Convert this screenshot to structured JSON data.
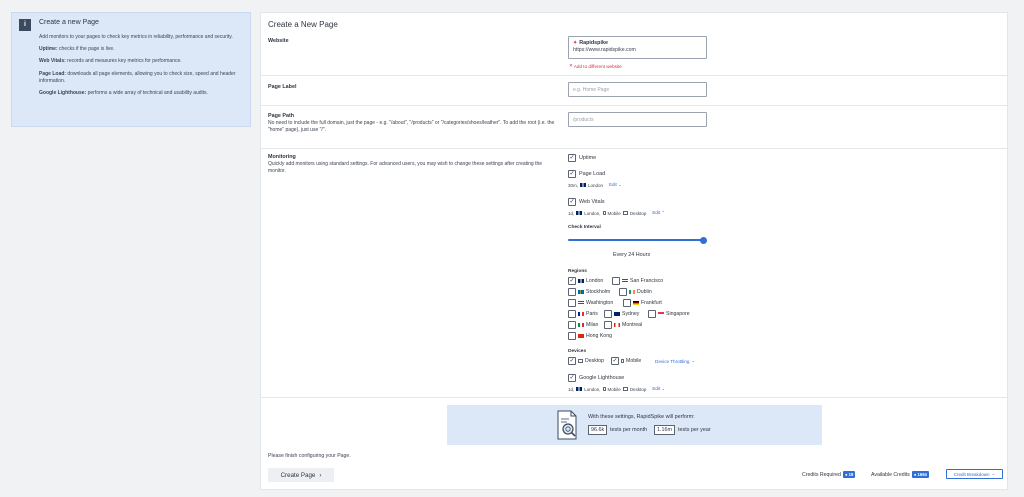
{
  "info": {
    "badge": "i",
    "title": "Create a new Page",
    "intro": "Add monitors to your pages to check key metrics in reliability, performance and security.",
    "items": [
      {
        "term": "Uptime:",
        "text": " checks if the page is live."
      },
      {
        "term": "Web Vitals:",
        "text": " records and measures key metrics for performance."
      },
      {
        "term": "Page Load:",
        "text": " downloads all page elements, allowing you to check size, speed and header information."
      },
      {
        "term": "Google Lighthouse:",
        "text": " performs a wide array of technical and usability audits."
      }
    ]
  },
  "form": {
    "title": "Create a New Page",
    "website": {
      "label": "Website",
      "site_name": "Rapidspike",
      "site_url": "https://www.rapidspike.com",
      "change_link": "Add to different website"
    },
    "page_label": {
      "label": "Page Label",
      "placeholder": "e.g. Home Page"
    },
    "page_path": {
      "label": "Page Path",
      "description": "No need to include the full domain, just the page - e.g. \"/about\", \"/products\" or \"/categories/shoes/leather\". To add the root (i.e. the \"home\" page), just use \"/\".",
      "placeholder": "/products"
    },
    "monitoring": {
      "label": "Monitoring",
      "description": "Quickly add monitors using standard settings. For advanced users, you may wish to change these settings after creating the monitor.",
      "uptime": "Uptime",
      "page_load": "Page Load",
      "page_load_interval": "30m,",
      "page_load_region": "London",
      "edit_label": "Edit",
      "web_vitals": "Web Vitals",
      "web_vitals_interval": "1d,",
      "web_vitals_region": "London,",
      "mobile": "Mobile",
      "desktop": "Desktop",
      "check_interval_label": "Check Interval",
      "check_interval_value": "Every 24 Hours",
      "check_interval_level": 1.0,
      "regions_label": "Regions",
      "regions": [
        {
          "name": "London",
          "checked": true
        },
        {
          "name": "San Francisco",
          "checked": false
        },
        {
          "name": "Stockholm",
          "checked": false
        },
        {
          "name": "Dublin",
          "checked": false
        },
        {
          "name": "Washington",
          "checked": false
        },
        {
          "name": "Frankfurt",
          "checked": false
        },
        {
          "name": "Paris",
          "checked": false
        },
        {
          "name": "Sydney",
          "checked": false
        },
        {
          "name": "Singapore",
          "checked": false
        },
        {
          "name": "Milan",
          "checked": false
        },
        {
          "name": "Montreal",
          "checked": false
        },
        {
          "name": "Hong Kong",
          "checked": false
        }
      ],
      "devices_label": "Devices",
      "device_desktop": "Desktop",
      "device_mobile": "Mobile",
      "device_throttling": "Device Throttling",
      "lighthouse": "Google Lighthouse",
      "lighthouse_interval": "1d,",
      "lighthouse_region": "London,"
    },
    "summary": {
      "line": "With these settings, RapidSpike will perform:",
      "monthly_value": "96.6k",
      "monthly_text": "tests per month",
      "yearly_value": "1.16m",
      "yearly_text": "tests per year"
    },
    "footer": {
      "finish_text": "Please finish configuring your Page.",
      "create_button": "Create Page",
      "credits_required_label": "Credits Required",
      "credits_required_value": "18",
      "available_credits_label": "Available Credits",
      "available_credits_value": "1694",
      "breakdown_button": "Credit Breakdown"
    }
  },
  "colors": {
    "accent": "#2f6fd6",
    "info_bg": "#dce8f7",
    "danger": "#d0304c"
  }
}
